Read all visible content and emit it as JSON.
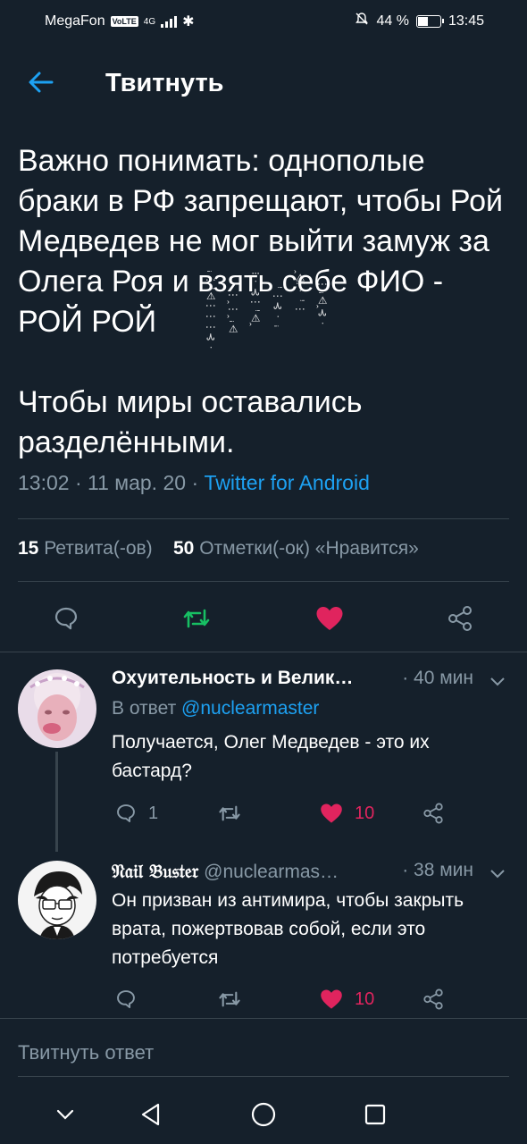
{
  "status_bar": {
    "carrier": "MegaFon",
    "volte": "VoLTE",
    "network": "4G",
    "battery_percent": "44 %",
    "time": "13:45",
    "battery_level": 0.44
  },
  "header": {
    "title": "Твитнуть"
  },
  "tweet": {
    "text": "Важно понимать: однополые браки в РФ запрещают, чтобы Рой Медведев не мог выйти замуж за Олега Роя и взять себе ФИО - РОЙ РОЙ\n\nЧтобы миры оставались разделёнными.",
    "time": "13:02",
    "date": "11 мар. 20",
    "source": "Twitter for Android",
    "zalgo_columns": [
      "ꜟ⋮ꜝ⩤⋮⋮⋮⊰ᐧ",
      "ᐧ⋮ꞈ⋮ꞈꜟ⩤",
      "⁝ᐧ⊰⋮ꜝ⩤ꞈ",
      "ꜝ⋮⊰ᐧꜟ",
      "ꞈ⩤⋮ᐧꜝ⋮",
      "⋮ꜟ⩤ꞈ⊰ᐧ"
    ]
  },
  "stats": {
    "retweets_count": "15",
    "retweets_label": "Ретвита(-ов)",
    "likes_count": "50",
    "likes_label": "Отметки(-ок) «Нравится»"
  },
  "colors": {
    "background": "#15202b",
    "accent": "#1da1f2",
    "retweet_green": "#17bf63",
    "like_red": "#e0245e",
    "muted": "#8899a6",
    "divider": "#38444d"
  },
  "replies": [
    {
      "name": "Охуительность и Велик…",
      "time": "· 40 мин",
      "reply_to_prefix": "В ответ",
      "reply_to_handle": "@nuclearmaster",
      "text": "Получается, Олег Медведев - это их бастард?",
      "reply_count": "1",
      "like_count": "10"
    },
    {
      "name": "𝔑𝔞𝔦𝔩 𝔅𝔲𝔰𝔱𝔢𝔯",
      "handle": "@nuclearmas…",
      "time": "· 38 мин",
      "text": "Он призван из антимира, чтобы закрыть врата, пожертвовав собой, если это потребуется",
      "like_count": "10"
    }
  ],
  "reply_box": {
    "placeholder": "Твитнуть ответ"
  }
}
